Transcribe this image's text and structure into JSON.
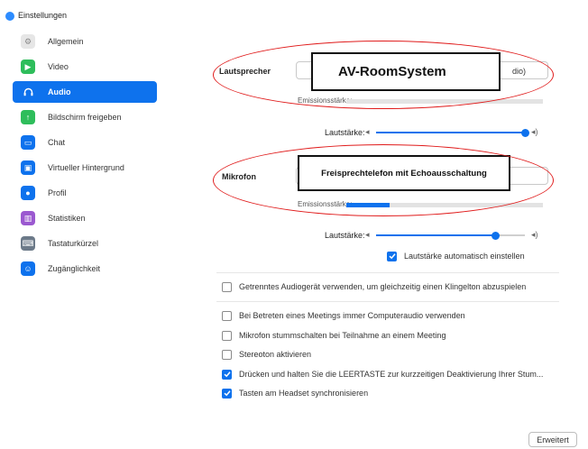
{
  "window": {
    "title": "Einstellungen"
  },
  "sidebar": {
    "items": [
      {
        "label": "Allgemein",
        "icon": "gear-icon",
        "color": "#e6e6e6",
        "active": false
      },
      {
        "label": "Video",
        "icon": "video-camera-icon",
        "color": "#2ebd5b",
        "active": false
      },
      {
        "label": "Audio",
        "icon": "headphones-icon",
        "color": "#0e72ed",
        "active": true
      },
      {
        "label": "Bildschirm freigeben",
        "icon": "screen-share-icon",
        "color": "#2ebd5b",
        "active": false
      },
      {
        "label": "Chat",
        "icon": "chat-bubble-icon",
        "color": "#0e72ed",
        "active": false
      },
      {
        "label": "Virtueller Hintergrund",
        "icon": "virtual-background-icon",
        "color": "#0e72ed",
        "active": false
      },
      {
        "label": "Profil",
        "icon": "profile-icon",
        "color": "#0e72ed",
        "active": false
      },
      {
        "label": "Statistiken",
        "icon": "statistics-icon",
        "color": "#9b59d0",
        "active": false
      },
      {
        "label": "Tastaturkürzel",
        "icon": "keyboard-icon",
        "color": "#6c7a89",
        "active": false
      },
      {
        "label": "Zugänglichkeit",
        "icon": "accessibility-icon",
        "color": "#0e72ed",
        "active": false
      }
    ]
  },
  "speaker": {
    "label": "Lautsprecher",
    "device_overlay": "AV-RoomSystem",
    "device_tail": "dio)",
    "output_level_label": "Emissionsstärke:",
    "volume_label": "Lautstärke:",
    "volume_fraction": 1.0
  },
  "microphone": {
    "label": "Mikrofon",
    "device_overlay": "Freisprechtelefon mit Echoausschaltung",
    "input_level_label": "Emissionsstärke:",
    "input_level_fraction": 0.22,
    "volume_label": "Lautstärke:",
    "volume_fraction": 0.8,
    "auto_adjust": {
      "label": "Lautstärke automatisch einstellen",
      "checked": true
    }
  },
  "options": [
    {
      "label": "Getrenntes Audiogerät verwenden, um gleichzeitig einen Klingelton abzuspielen",
      "checked": false
    },
    {
      "label": "Bei Betreten eines Meetings immer Computeraudio verwenden",
      "checked": false
    },
    {
      "label": "Mikrofon stummschalten bei Teilnahme an einem Meeting",
      "checked": false
    },
    {
      "label": "Stereoton aktivieren",
      "checked": false
    },
    {
      "label": "Drücken und halten Sie die LEERTASTE zur kurzzeitigen Deaktivierung Ihrer Stum...",
      "checked": true
    },
    {
      "label": "Tasten am Headset synchronisieren",
      "checked": true
    }
  ],
  "advanced_button": "Erweitert"
}
